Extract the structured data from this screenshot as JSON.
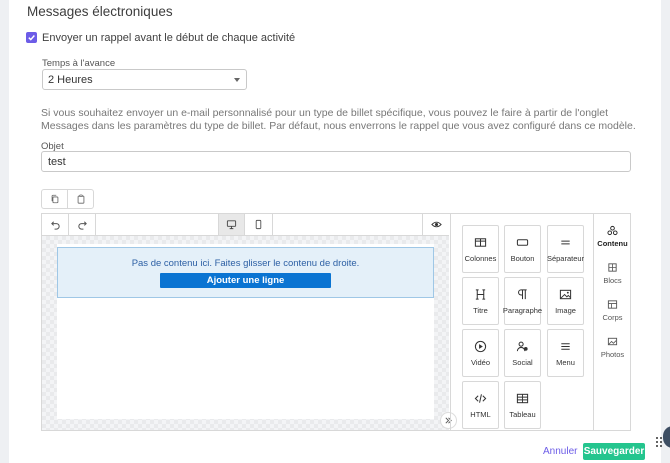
{
  "section": {
    "title": "Messages électroniques"
  },
  "reminder": {
    "checked": true,
    "label": "Envoyer un rappel avant le début de chaque activité"
  },
  "advance": {
    "label": "Temps à l'avance",
    "value": "2 Heures",
    "options": [
      "2 Heures"
    ]
  },
  "help_text": "Si vous souhaitez envoyer un e-mail personnalisé pour un type de billet spécifique, vous pouvez le faire à partir de l'onglet Messages dans les paramètres du type de billet. Par défaut, nous enverrons le rappel que vous avez configuré dans ce modèle.",
  "subject": {
    "label": "Objet",
    "value": "test"
  },
  "editor": {
    "empty_message": "Pas de contenu ici. Faites glisser le contenu de droite.",
    "add_row_label": "Ajouter une ligne"
  },
  "blocks": [
    {
      "label": "Colonnes",
      "icon": "columns-icon"
    },
    {
      "label": "Bouton",
      "icon": "button-icon"
    },
    {
      "label": "Séparateur",
      "icon": "divider-icon"
    },
    {
      "label": "Titre",
      "icon": "heading-icon"
    },
    {
      "label": "Paragraphe",
      "icon": "paragraph-icon"
    },
    {
      "label": "Image",
      "icon": "image-icon"
    },
    {
      "label": "Vidéo",
      "icon": "video-icon"
    },
    {
      "label": "Social",
      "icon": "social-icon"
    },
    {
      "label": "Menu",
      "icon": "menu-icon"
    },
    {
      "label": "HTML",
      "icon": "code-icon"
    },
    {
      "label": "Tableau",
      "icon": "table-icon"
    }
  ],
  "tabs": [
    {
      "label": "Contenu",
      "icon": "content-icon",
      "active": true
    },
    {
      "label": "Blocs",
      "icon": "blocks-icon",
      "active": false
    },
    {
      "label": "Corps",
      "icon": "body-icon",
      "active": false
    },
    {
      "label": "Photos",
      "icon": "photos-icon",
      "active": false
    }
  ],
  "footer": {
    "cancel_label": "Annuler",
    "save_label": "Sauvegarder"
  },
  "colors": {
    "accent": "#6c5ce7",
    "save": "#24c58e",
    "primary_button": "#0a74d2"
  }
}
